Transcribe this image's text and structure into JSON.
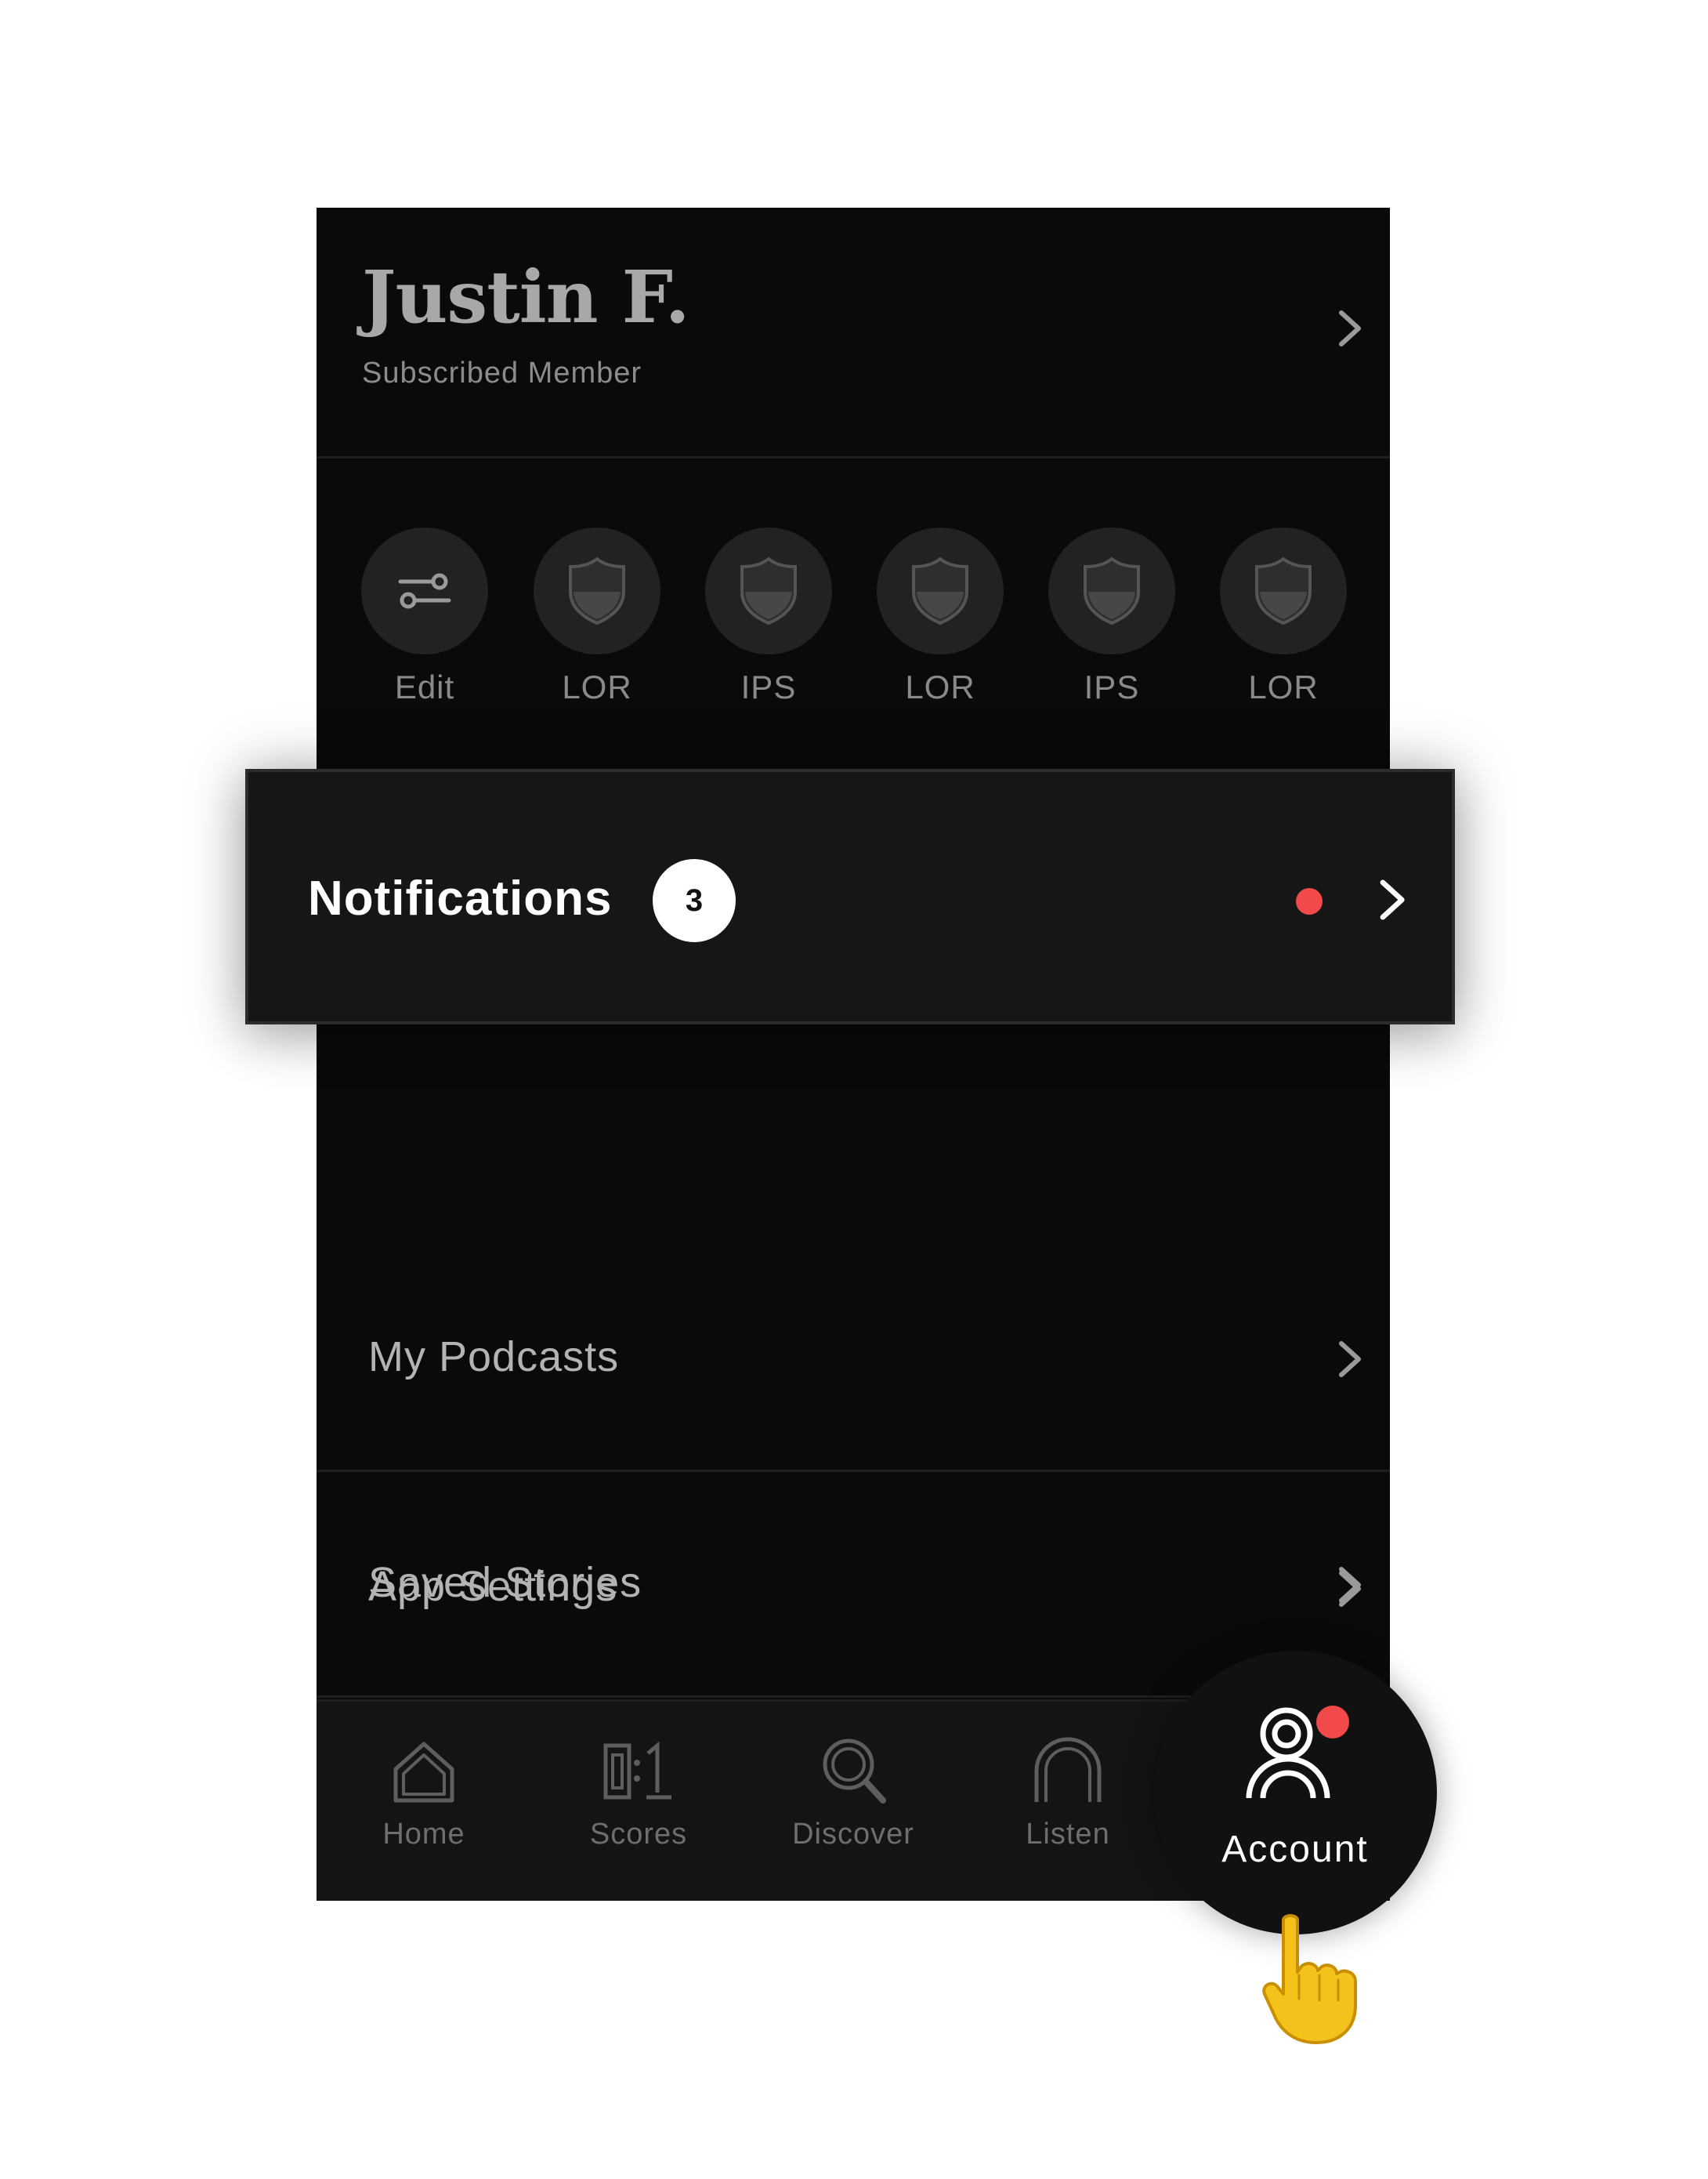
{
  "profile": {
    "name": "Justin F.",
    "status": "Subscribed Member"
  },
  "badges": [
    {
      "label": "Edit",
      "icon": "sliders-icon"
    },
    {
      "label": "LOR",
      "icon": "shield-icon"
    },
    {
      "label": "IPS",
      "icon": "shield-icon"
    },
    {
      "label": "LOR",
      "icon": "shield-icon"
    },
    {
      "label": "IPS",
      "icon": "shield-icon"
    },
    {
      "label": "LOR",
      "icon": "shield-icon"
    }
  ],
  "notifications": {
    "label": "Notifications",
    "count": "3",
    "unread_indicator_color": "#f24a4a"
  },
  "menu": [
    {
      "label": "My Podcasts"
    },
    {
      "label": "Saved Stories"
    },
    {
      "label": "App Settings"
    }
  ],
  "tabs": [
    {
      "label": "Home",
      "icon": "home-icon"
    },
    {
      "label": "Scores",
      "icon": "scores-icon"
    },
    {
      "label": "Discover",
      "icon": "search-icon"
    },
    {
      "label": "Listen",
      "icon": "headphones-icon"
    },
    {
      "label": "Account",
      "icon": "account-icon",
      "active": true
    }
  ],
  "colors": {
    "background": "#0a0a0a",
    "accent_red": "#f24a4a",
    "text_primary": "#ffffff",
    "text_secondary": "#8c8c8c"
  }
}
